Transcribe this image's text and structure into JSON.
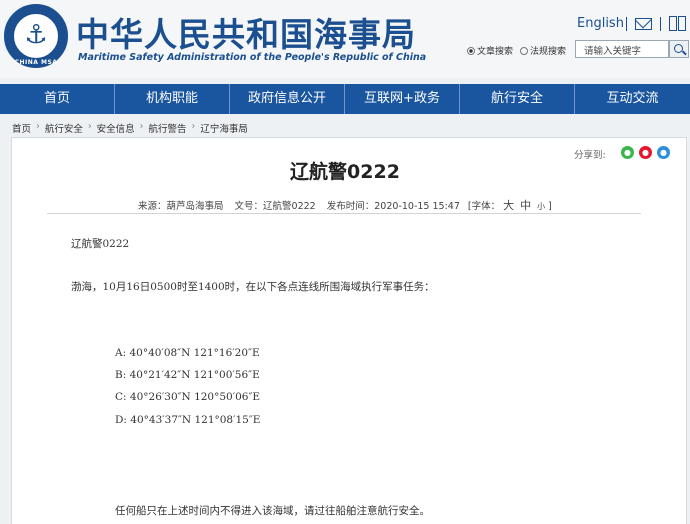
{
  "header": {
    "logo_text": "CHINA MSA",
    "site_title": "中华人民共和国海事局",
    "site_subtitle": "Maritime Safety Administration of the People's Republic of China",
    "lang_link": "English",
    "search_options": [
      "文章搜索",
      "法规搜索"
    ],
    "search_placeholder": "请输入关键字"
  },
  "nav": [
    "首页",
    "机构职能",
    "政府信息公开",
    "互联网+政务",
    "航行安全",
    "互动交流"
  ],
  "breadcrumb": [
    "首页",
    "航行安全",
    "安全信息",
    "航行警告",
    "辽宁海事局"
  ],
  "article": {
    "share_label": "分享到:",
    "title": "辽航警0222",
    "meta": {
      "source": "来源：葫芦岛海事局",
      "doc_no": "文号：辽航警0222",
      "date": "发布时间：2020-10-15 15:47",
      "font_label": "[字体：",
      "font_large": "大",
      "font_medium": "中",
      "font_small": "小",
      "font_close": "]"
    },
    "heading": "辽航警0222",
    "intro": "渤海，10月16日0500时至1400时，在以下各点连线所围海域执行军事任务：",
    "coords": [
      "A:  40°40′08″N  121°16′20″E",
      "B:  40°21′42″N  121°00′56″E",
      "C:  40°26′30″N  120°50′06″E",
      "D:  40°43′37″N  121°08′15″E"
    ],
    "notice": "任何船只在上述时间内不得进入该海域，请过往船舶注意航行安全。"
  },
  "colors": {
    "brand": "#1b4f8f",
    "nav_bg": "#1a56a0",
    "page_bg": "#eef1f4"
  }
}
